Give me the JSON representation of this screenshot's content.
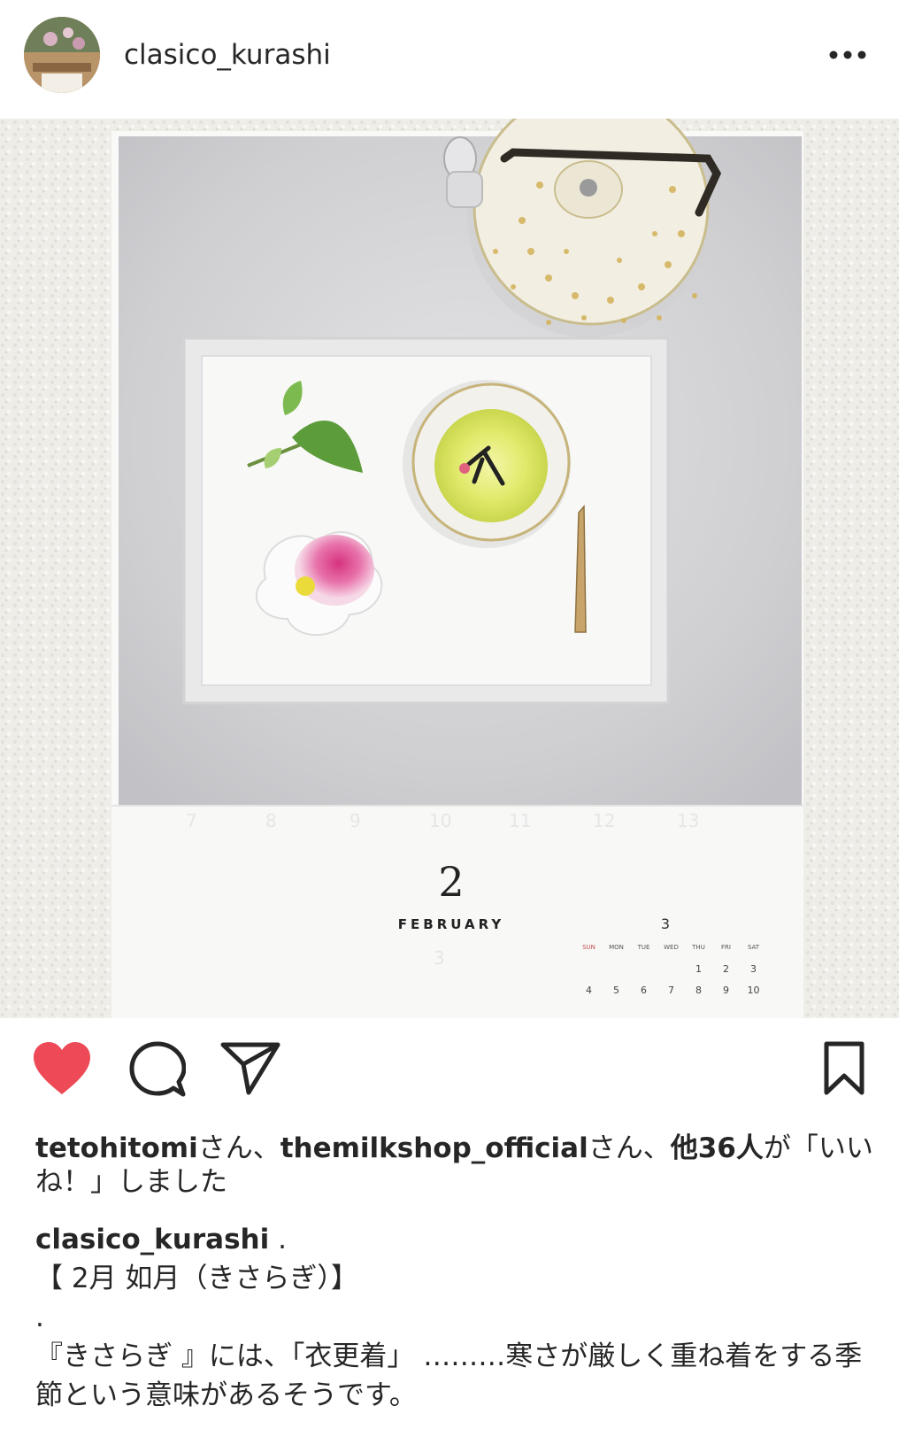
{
  "header": {
    "username": "clasico_kurashi",
    "avatar_icon": "avatar-photo",
    "more_icon": "more-horizontal-icon"
  },
  "photo": {
    "calendar": {
      "month_number": "2",
      "month_name": "FEBRUARY",
      "mini_month_number": "3",
      "mini_weekdays": [
        "SUN",
        "MON",
        "TUE",
        "WED",
        "THU",
        "FRI",
        "SAT"
      ],
      "mini_days": [
        "",
        "",
        "",
        "",
        "1",
        "2",
        "3",
        "4",
        "5",
        "6",
        "7",
        "8",
        "9",
        "10"
      ]
    }
  },
  "actions": {
    "like_icon": "heart-filled-icon",
    "comment_icon": "comment-icon",
    "share_icon": "send-icon",
    "save_icon": "bookmark-icon",
    "like_color": "#ed4956"
  },
  "likes": {
    "user1": "tetohitomi",
    "sep1": "さん、",
    "user2": "themilkshop_official",
    "sep2": "さん、",
    "others": "他36人",
    "suffix": "が「いいね！」しました"
  },
  "caption": {
    "username": "clasico_kurashi",
    "first_line_rest": " .",
    "lines": [
      "【 2月 如月（きさらぎ）】",
      ".",
      "『きさらぎ 』には、「衣更着」 ………寒さが厳しく重ね着をする季節という意味があるそうです。"
    ]
  }
}
